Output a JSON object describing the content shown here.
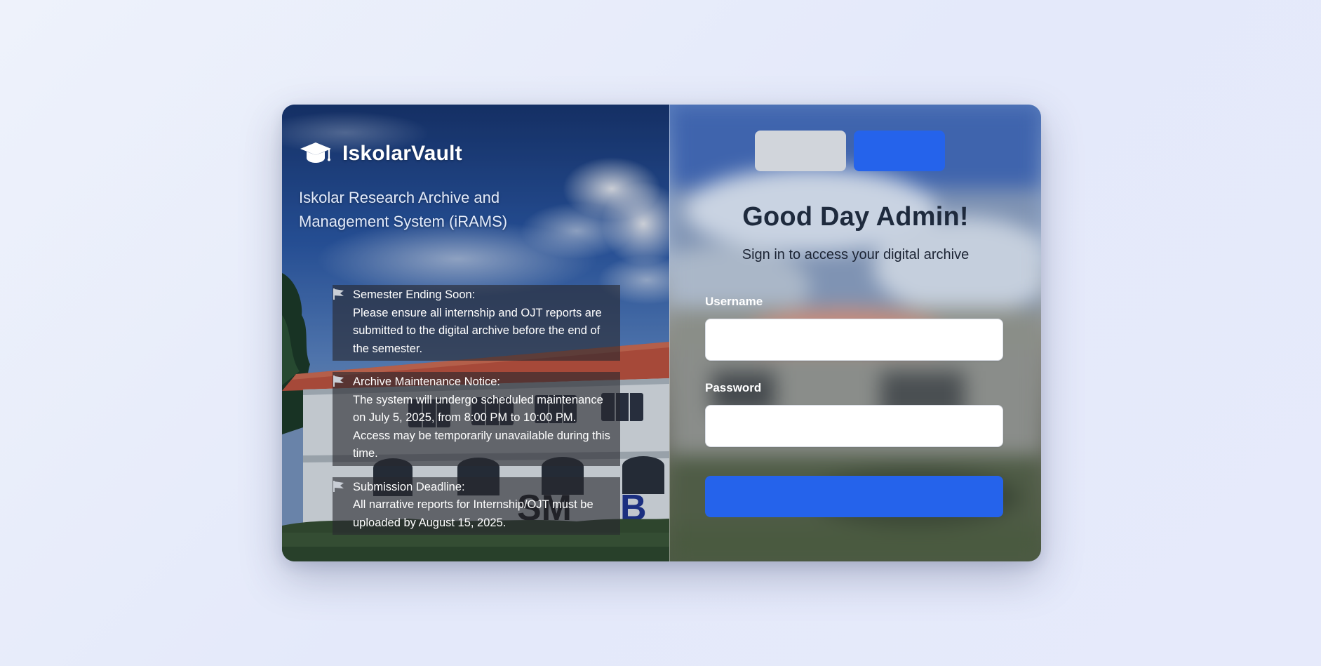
{
  "brand": {
    "name": "IskolarVault",
    "tagline": "Iskolar Research Archive and Management System (iRAMS)",
    "icon": "graduation-cap-icon"
  },
  "announcements": [
    {
      "title": "Semester Ending Soon:",
      "body": "Please ensure all internship and OJT reports are submitted to the digital archive before the end of the semester.",
      "icon": "flag-icon"
    },
    {
      "title": "Archive Maintenance Notice:",
      "body": "The system will undergo scheduled maintenance on July 5, 2025, from 8:00 PM to 10:00 PM. Access may be temporarily unavailable during this time.",
      "icon": "flag-icon"
    },
    {
      "title": "Submission Deadline:",
      "body": "All narrative reports for Internship/OJT must be uploaded by August 15, 2025.",
      "icon": "flag-icon"
    }
  ],
  "building_sign": "SMB",
  "login": {
    "greeting": "Good Day Admin!",
    "subtitle": "Sign in to access your digital archive",
    "username_label": "Username",
    "username_value": "",
    "password_label": "Password",
    "password_value": "",
    "tabs": [
      {
        "label": "",
        "active": false
      },
      {
        "label": "",
        "active": true
      }
    ],
    "submit_label": ""
  },
  "colors": {
    "accent": "#2563eb",
    "tab_inactive": "#d1d5db",
    "heading": "#1e2a3d"
  }
}
